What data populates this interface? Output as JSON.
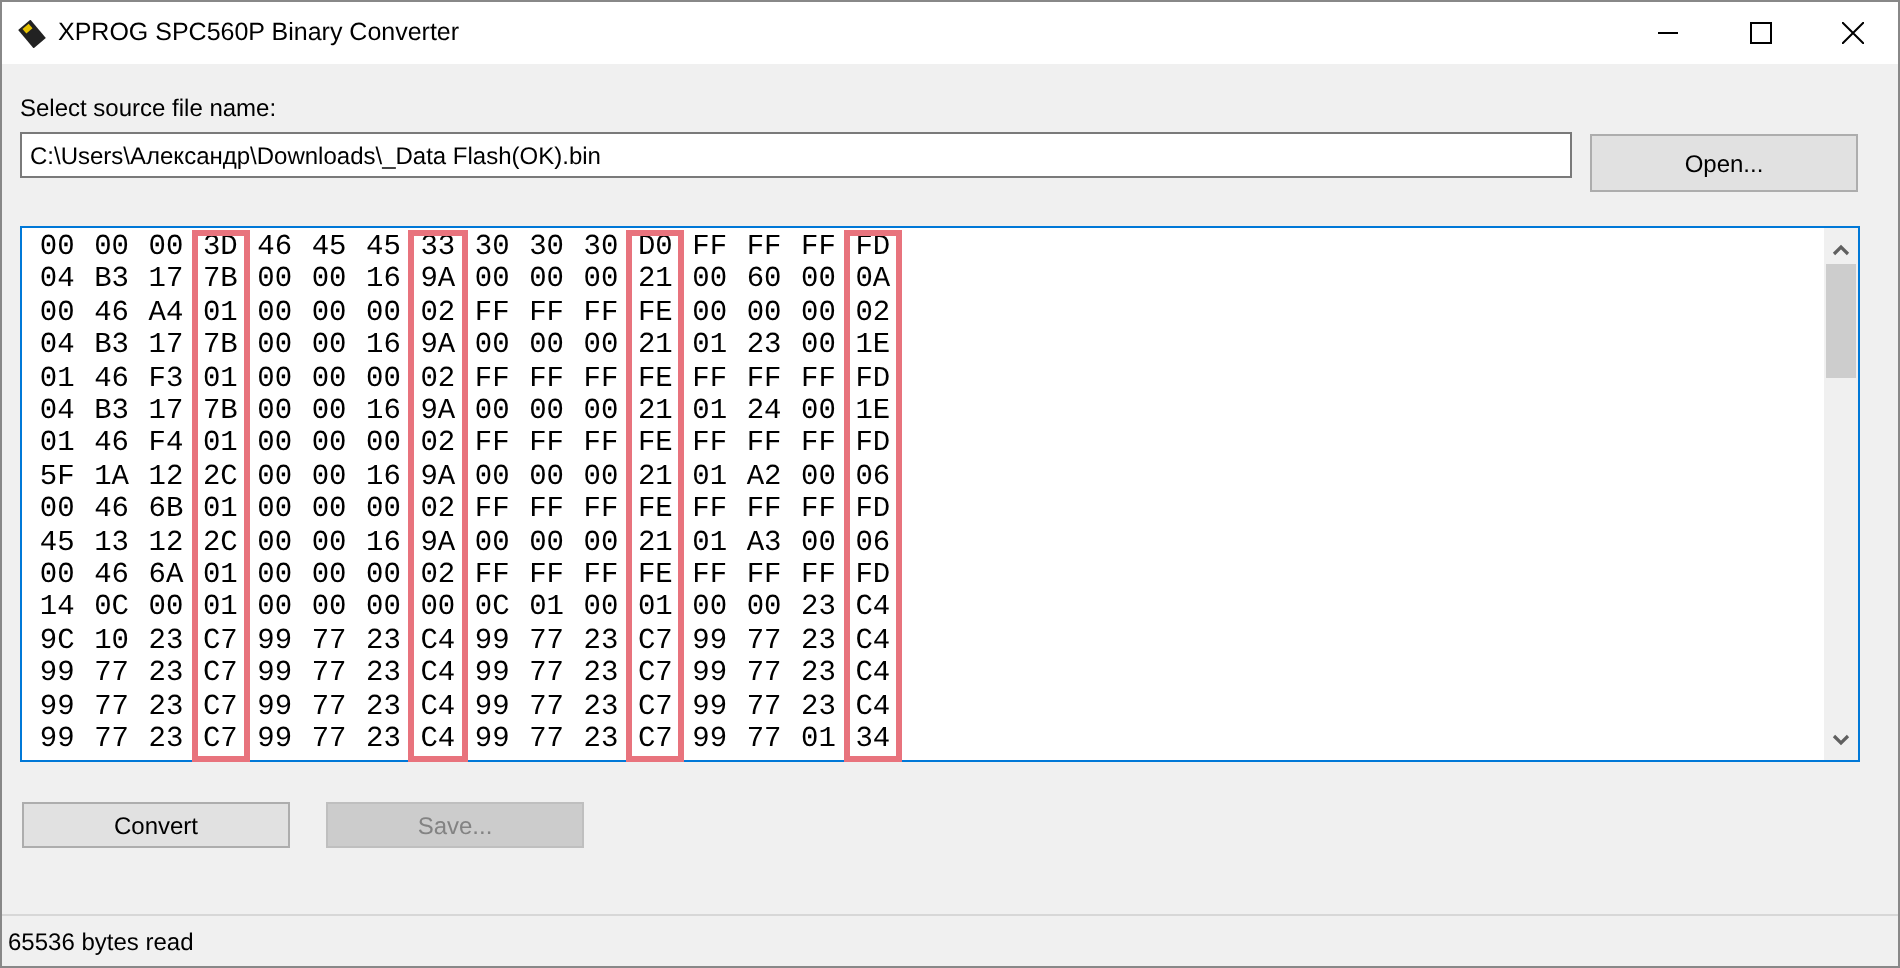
{
  "window": {
    "title": "XPROG SPC560P Binary Converter"
  },
  "source": {
    "label": "Select source file name:",
    "value": "C:\\Users\\Александр\\Downloads\\_Data Flash(OK).bin",
    "button": "Open..."
  },
  "hex_view": {
    "columns": [
      {
        "highlighted": false
      },
      {
        "highlighted": false
      },
      {
        "highlighted": false
      },
      {
        "highlighted": true
      },
      {
        "highlighted": false
      },
      {
        "highlighted": false
      },
      {
        "highlighted": false
      },
      {
        "highlighted": true
      },
      {
        "highlighted": false
      },
      {
        "highlighted": false
      },
      {
        "highlighted": false
      },
      {
        "highlighted": true
      },
      {
        "highlighted": false
      },
      {
        "highlighted": false
      },
      {
        "highlighted": false
      },
      {
        "highlighted": true
      }
    ],
    "rows": [
      "00 00 00 3D 46 45 45 33 30 30 30 D0 FF FF FF FD",
      "04 B3 17 7B 00 00 16 9A 00 00 00 21 00 60 00 0A",
      "00 46 A4 01 00 00 00 02 FF FF FF FE 00 00 00 02",
      "04 B3 17 7B 00 00 16 9A 00 00 00 21 01 23 00 1E",
      "01 46 F3 01 00 00 00 02 FF FF FF FE FF FF FF FD",
      "04 B3 17 7B 00 00 16 9A 00 00 00 21 01 24 00 1E",
      "01 46 F4 01 00 00 00 02 FF FF FF FE FF FF FF FD",
      "5F 1A 12 2C 00 00 16 9A 00 00 00 21 01 A2 00 06",
      "00 46 6B 01 00 00 00 02 FF FF FF FE FF FF FF FD",
      "45 13 12 2C 00 00 16 9A 00 00 00 21 01 A3 00 06",
      "00 46 6A 01 00 00 00 02 FF FF FF FE FF FF FF FD",
      "14 0C 00 01 00 00 00 00 0C 01 00 01 00 00 23 C4",
      "9C 10 23 C7 99 77 23 C4 99 77 23 C7 99 77 23 C4",
      "99 77 23 C7 99 77 23 C4 99 77 23 C7 99 77 23 C4",
      "99 77 23 C7 99 77 23 C4 99 77 23 C7 99 77 23 C4",
      "99 77 23 C7 99 77 23 C4 99 77 23 C7 99 77 01 34"
    ]
  },
  "buttons": [
    {
      "label": "Convert",
      "disabled": false
    },
    {
      "label": "Save...",
      "disabled": true
    }
  ],
  "status_bar": "65536 bytes read"
}
